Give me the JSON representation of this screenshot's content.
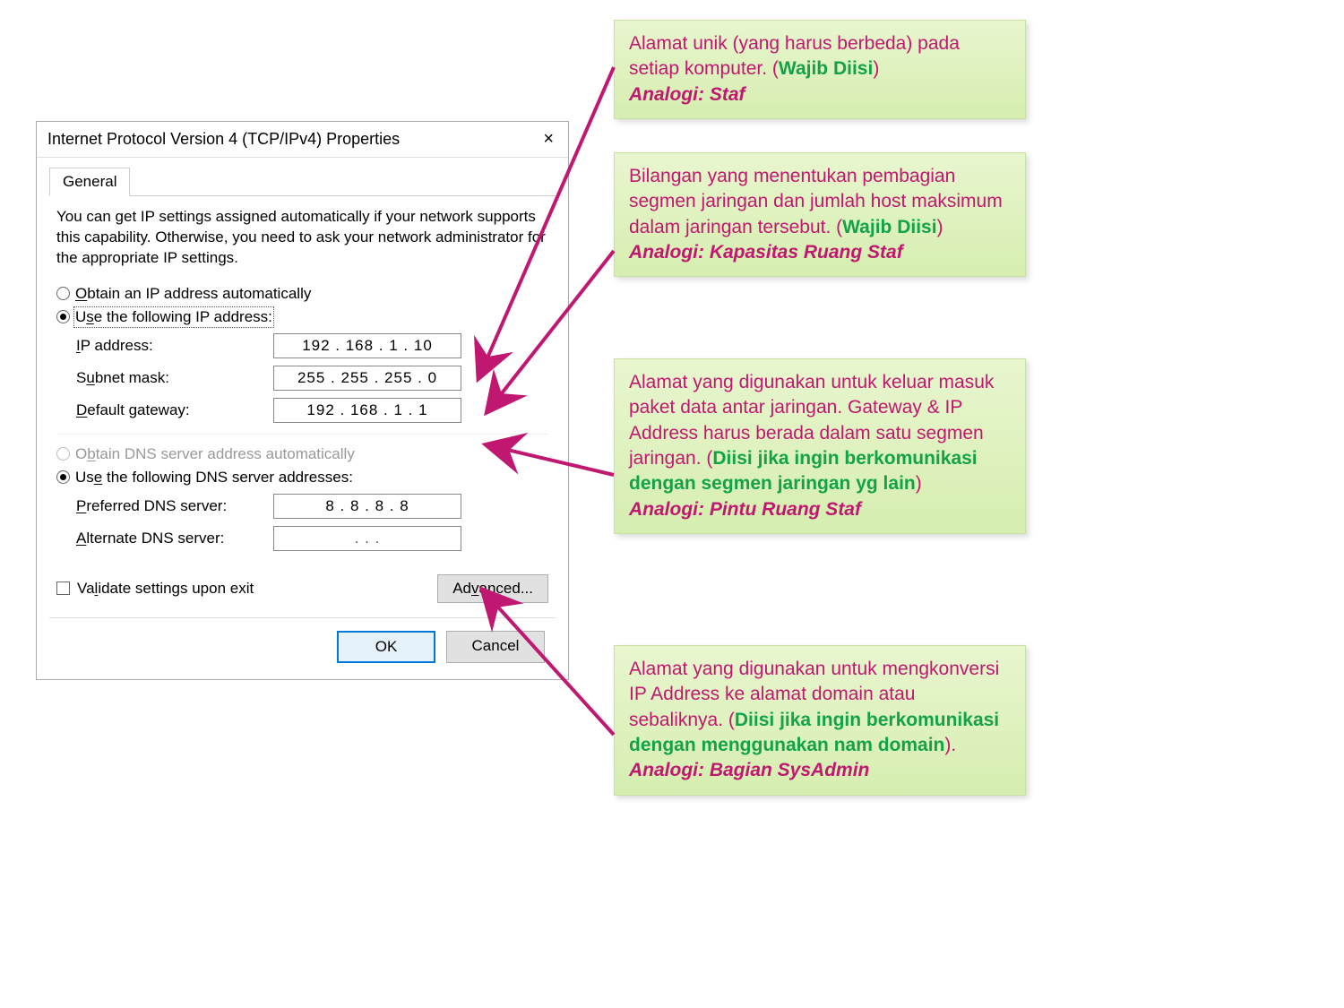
{
  "dialog": {
    "title": "Internet Protocol Version 4 (TCP/IPv4) Properties",
    "tab": "General",
    "description": "You can get IP settings assigned automatically if your network supports this capability. Otherwise, you need to ask your network administrator for the appropriate IP settings.",
    "radio_obtain_ip": "Obtain an IP address automatically",
    "radio_use_ip": "Use the following IP address:",
    "ip_label": "IP address:",
    "ip_value": "192 . 168 .  1  .  10",
    "subnet_label": "Subnet mask:",
    "subnet_value": "255 . 255 . 255 .  0",
    "gateway_label": "Default gateway:",
    "gateway_value": "192 . 168 .  1  .  1",
    "radio_obtain_dns": "Obtain DNS server address automatically",
    "radio_use_dns": "Use the following DNS server addresses:",
    "pref_dns_label": "Preferred DNS server:",
    "pref_dns_value": "8  .  8  .  8  .  8",
    "alt_dns_label": "Alternate DNS server:",
    "alt_dns_value": ".        .        .",
    "validate": "Validate settings upon exit",
    "advanced": "Advanced...",
    "ok": "OK",
    "cancel": "Cancel"
  },
  "annotations": [
    {
      "text1": "Alamat unik (yang harus berbeda) pada setiap komputer. (",
      "req": "Wajib Diisi",
      "text2": ")",
      "analogy": "Analogi: Staf"
    },
    {
      "text1": "Bilangan yang menentukan pembagian segmen jaringan dan jumlah host maksimum dalam jaringan tersebut. (",
      "req": "Wajib Diisi",
      "text2": ")",
      "analogy": "Analogi: Kapasitas Ruang Staf"
    },
    {
      "text1": "Alamat yang digunakan untuk keluar masuk paket data antar jaringan. Gateway & IP Address harus berada dalam satu segmen jaringan. (",
      "req": "Diisi jika ingin berkomunikasi dengan segmen jaringan yg lain",
      "text2": ")",
      "analogy": "Analogi: Pintu Ruang Staf"
    },
    {
      "text1": "Alamat yang digunakan untuk mengkonversi IP Address ke alamat domain atau sebaliknya. (",
      "req": "Diisi jika ingin berkomunikasi dengan menggunakan nam domain",
      "text2": ").",
      "analogy": "Analogi: Bagian SysAdmin"
    }
  ]
}
